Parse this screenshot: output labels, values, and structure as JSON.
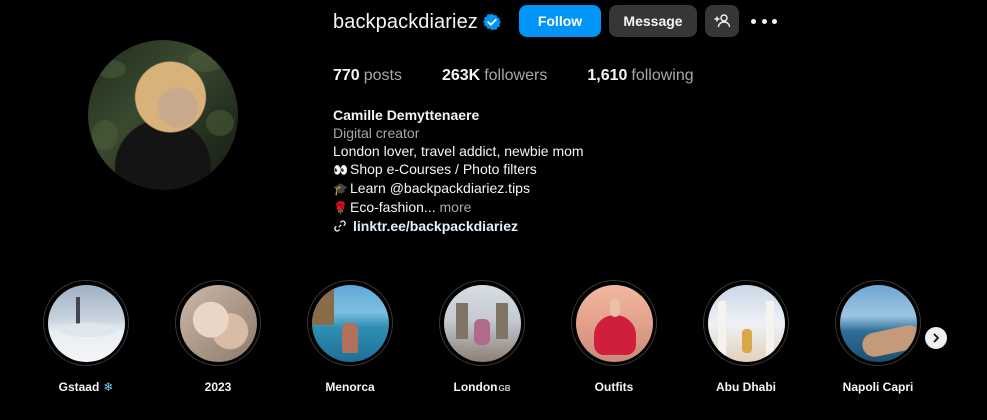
{
  "profile": {
    "username": "backpackdiariez",
    "verified": true,
    "actions": {
      "follow_label": "Follow",
      "message_label": "Message",
      "add_user_icon": "person-plus-icon",
      "more_icon": "more-dots-icon"
    },
    "stats": {
      "posts_count": "770",
      "posts_label": "posts",
      "followers_count": "263K",
      "followers_label": "followers",
      "following_count": "1,610",
      "following_label": "following"
    },
    "bio": {
      "full_name": "Camille Demyttenaere",
      "category": "Digital creator",
      "line1": "London lover, travel addict, newbie mom",
      "line2_emoji": "👀",
      "line2_text": "Shop e-Courses / Photo filters",
      "line3_emoji": "🎓",
      "line3_text": "Learn @backpackdiariez.tips",
      "line4_emoji": "🌹",
      "line4_text": "Eco-fashion...",
      "more_label": "more",
      "link_icon": "link-icon",
      "link_text": "linktr.ee/backpackdiariez"
    }
  },
  "highlights": [
    {
      "label": "Gstaad",
      "suffix": "❄",
      "flag": ""
    },
    {
      "label": "2023",
      "suffix": "",
      "flag": ""
    },
    {
      "label": "Menorca",
      "suffix": "",
      "flag": ""
    },
    {
      "label": "London",
      "suffix": "",
      "flag": "GB"
    },
    {
      "label": "Outfits",
      "suffix": "",
      "flag": ""
    },
    {
      "label": "Abu Dhabi",
      "suffix": "",
      "flag": ""
    },
    {
      "label": "Napoli Capri",
      "suffix": "",
      "flag": ""
    }
  ],
  "colors": {
    "background": "#000000",
    "follow_button": "#0095f6",
    "secondary_button": "#363636",
    "verified_badge": "#0095f6",
    "muted_text": "#a8a8a8"
  }
}
